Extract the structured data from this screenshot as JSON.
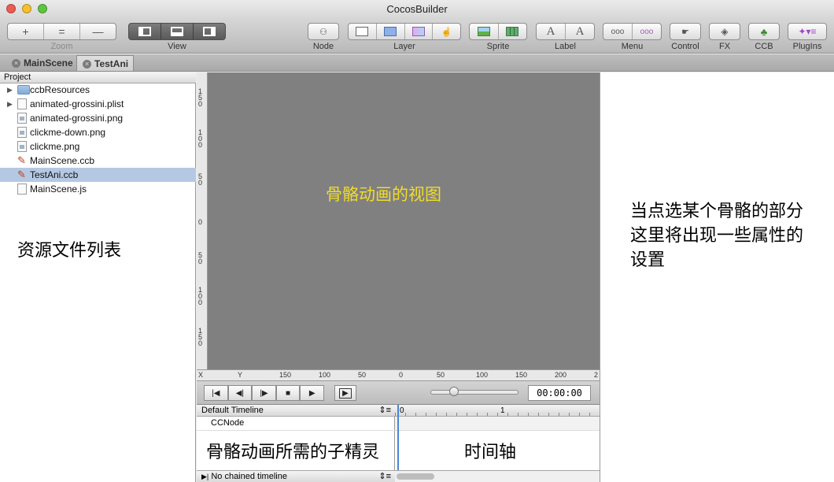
{
  "window": {
    "title": "CocosBuilder",
    "traffic_colors": {
      "close": "#ee5b51",
      "minimize": "#f5bf2d",
      "zoom": "#5ec53e"
    }
  },
  "toolbar": {
    "zoom_label": "Zoom",
    "zoom_buttons": [
      "+",
      "=",
      "—"
    ],
    "view_label": "View",
    "node_label": "Node",
    "layer_label": "Layer",
    "sprite_label": "Sprite",
    "label_label": "Label",
    "label_glyphs": [
      "A",
      "A"
    ],
    "menu_label": "Menu",
    "menu_glyphs": [
      "ooo",
      "ooo"
    ],
    "control_label": "Control",
    "fx_label": "FX",
    "ccb_label": "CCB",
    "plugins_label": "PlugIns"
  },
  "tabs": [
    {
      "label": "MainScene",
      "active": false
    },
    {
      "label": "TestAni",
      "active": true
    }
  ],
  "project": {
    "header": "Project",
    "files": [
      {
        "name": "ccbResources",
        "type": "folder",
        "expandable": true,
        "selected": false
      },
      {
        "name": "animated-grossini.plist",
        "type": "file",
        "expandable": true,
        "selected": false
      },
      {
        "name": "animated-grossini.png",
        "type": "image",
        "expandable": false,
        "selected": false
      },
      {
        "name": "clickme-down.png",
        "type": "image",
        "expandable": false,
        "selected": false
      },
      {
        "name": "clickme.png",
        "type": "image",
        "expandable": false,
        "selected": false
      },
      {
        "name": "MainScene.ccb",
        "type": "ccb",
        "expandable": false,
        "selected": false
      },
      {
        "name": "TestAni.ccb",
        "type": "ccb",
        "expandable": false,
        "selected": true
      },
      {
        "name": "MainScene.js",
        "type": "file",
        "expandable": false,
        "selected": false
      }
    ],
    "annotation": "资源文件列表"
  },
  "canvas": {
    "annotation": "骨骼动画的视图",
    "annotation_color": "#f0dc2a",
    "background": "#808080",
    "ruler_v_ticks": [
      "150",
      "100",
      "50",
      "0",
      "50",
      "100",
      "150"
    ],
    "ruler_h_labels": [
      "X",
      "Y"
    ],
    "ruler_h_ticks": [
      "150",
      "100",
      "50",
      "0",
      "50",
      "100",
      "150",
      "200",
      "2"
    ]
  },
  "playback": {
    "buttons": [
      "|◀",
      "◀|",
      "|▶",
      "■",
      "▶",
      "▶"
    ],
    "timecode": "00:00:00"
  },
  "timeline": {
    "default_label": "Default Timeline",
    "node_label": "CCNode",
    "chained_label": "No chained timeline",
    "ruler_marks": [
      "0",
      "1"
    ],
    "left_annotation": "骨骼动画所需的子精灵",
    "right_annotation": "时间轴"
  },
  "inspector": {
    "annotation_lines": [
      "当点选某个骨骼的部分",
      "这里将出现一些属性的",
      "设置"
    ]
  }
}
